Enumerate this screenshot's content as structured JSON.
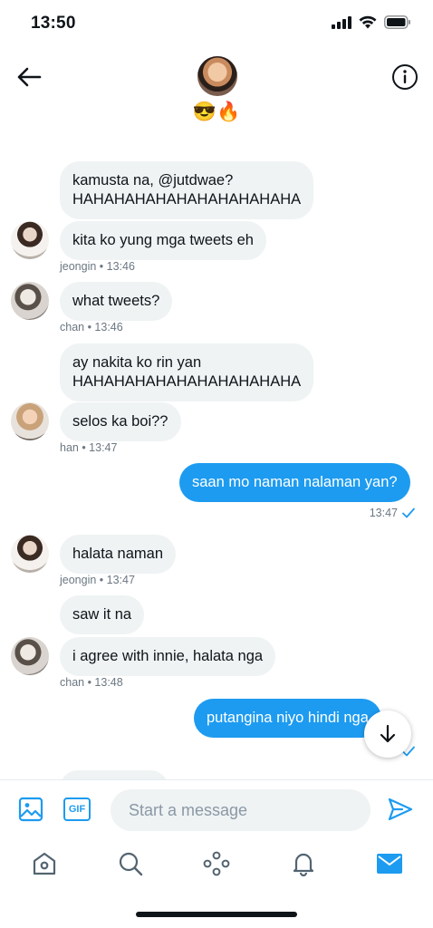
{
  "status_bar": {
    "time": "13:50"
  },
  "header": {
    "emoji": "😎🔥",
    "icons": [
      "back-arrow-icon",
      "info-icon"
    ]
  },
  "messages": [
    {
      "text": "kamusta na, @jutdwae?",
      "text2": "HAHAHAHAHAHAHAHAHAHAHA",
      "direction": "in"
    },
    {
      "text": "kita ko yung mga tweets eh",
      "direction": "in",
      "sender": "jeongin",
      "time": "13:46"
    },
    {
      "text": "what tweets?",
      "direction": "in",
      "sender": "chan",
      "time": "13:46"
    },
    {
      "text": "ay nakita ko rin yan",
      "text2": "HAHAHAHAHAHAHAHAHAHAHA",
      "direction": "in"
    },
    {
      "text": "selos ka boi??",
      "direction": "in",
      "sender": "han",
      "time": "13:47"
    },
    {
      "text": "saan mo naman nalaman yan?",
      "direction": "out",
      "time": "13:47"
    },
    {
      "text": "halata naman",
      "direction": "in",
      "sender": "jeongin",
      "time": "13:47"
    },
    {
      "text": "saw it na",
      "direction": "in"
    },
    {
      "text": "i agree with innie, halata nga",
      "direction": "in",
      "sender": "chan",
      "time": "13:48"
    },
    {
      "text": "putangina niyo hindi nga",
      "direction": "out"
    }
  ],
  "meta": {
    "m1": "jeongin • 13:46",
    "m2": "chan • 13:46",
    "m4": "han • 13:47",
    "m5": "13:47",
    "m6": "jeongin • 13:47",
    "m8": "chan • 13:48"
  },
  "composer": {
    "placeholder": "Start a message",
    "gif_label": "GIF"
  },
  "tabbar": {
    "items": [
      "home-icon",
      "search-icon",
      "spaces-icon",
      "notifications-icon",
      "messages-icon"
    ],
    "active": "messages-icon"
  },
  "colors": {
    "accent": "#1d9bf0",
    "incoming_bubble": "#eff3f4",
    "meta_text": "#6b7782"
  }
}
